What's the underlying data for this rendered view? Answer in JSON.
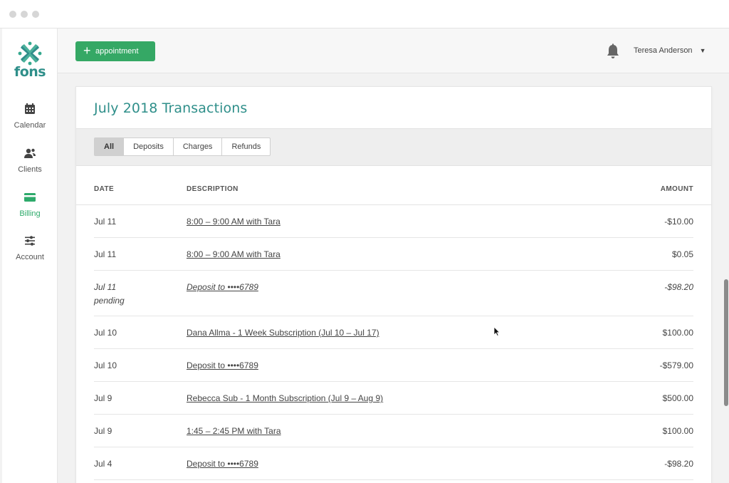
{
  "app": {
    "logo_text": "fons"
  },
  "sidebar": {
    "items": [
      {
        "label": "Calendar",
        "icon": "calendar-icon",
        "active": false
      },
      {
        "label": "Clients",
        "icon": "clients-icon",
        "active": false
      },
      {
        "label": "Billing",
        "icon": "card-icon",
        "active": true
      },
      {
        "label": "Account",
        "icon": "sliders-icon",
        "active": false
      }
    ]
  },
  "topbar": {
    "appointment_button": "appointment",
    "user_name": "Teresa Anderson"
  },
  "card": {
    "title": "July 2018 Transactions",
    "filters": [
      "All",
      "Deposits",
      "Charges",
      "Refunds"
    ],
    "active_filter": "All",
    "columns": {
      "date": "DATE",
      "description": "DESCRIPTION",
      "amount": "AMOUNT"
    },
    "rows": [
      {
        "date": "Jul 11",
        "status": "",
        "description": "8:00 – 9:00 AM with Tara",
        "amount": "-$10.00"
      },
      {
        "date": "Jul 11",
        "status": "",
        "description": "8:00 – 9:00 AM with Tara",
        "amount": "$0.05"
      },
      {
        "date": "Jul 11",
        "status": "pending",
        "description": "Deposit to ••••6789",
        "amount": "-$98.20"
      },
      {
        "date": "Jul 10",
        "status": "",
        "description": "Dana Allma - 1 Week Subscription (Jul 10 – Jul 17)",
        "amount": "$100.00"
      },
      {
        "date": "Jul 10",
        "status": "",
        "description": "Deposit to ••••6789",
        "amount": "-$579.00"
      },
      {
        "date": "Jul 9",
        "status": "",
        "description": "Rebecca Sub - 1 Month Subscription (Jul 9 – Aug 9)",
        "amount": "$500.00"
      },
      {
        "date": "Jul 9",
        "status": "",
        "description": "1:45 – 2:45 PM with Tara",
        "amount": "$100.00"
      },
      {
        "date": "Jul 4",
        "status": "",
        "description": "Deposit to ••••6789",
        "amount": "-$98.20"
      }
    ]
  },
  "colors": {
    "brand_teal": "#2f8f8a",
    "accent_green": "#35a865",
    "active_nav": "#2eaa6b"
  }
}
